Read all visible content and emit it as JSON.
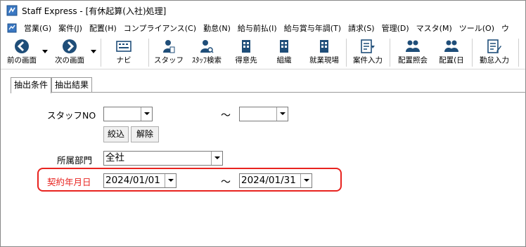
{
  "window": {
    "title": "Staff Express - [有休起算(入社)処理]"
  },
  "menubar": {
    "items": [
      "営業(G)",
      "案件(J)",
      "配置(H)",
      "コンプライアンス(C)",
      "勤怠(N)",
      "給与前払(I)",
      "給与賞与年調(T)",
      "請求(S)",
      "管理(D)",
      "マスタ(M)",
      "ツール(O)",
      "ウ"
    ]
  },
  "toolbar": {
    "buttons": [
      {
        "label": "前の画面",
        "icon": "arrow-left-circle-icon"
      },
      {
        "label": "次の画面",
        "icon": "arrow-right-circle-icon"
      },
      {
        "label": "ナビ",
        "icon": "navi-keyboard-icon"
      },
      {
        "label": "スタッフ",
        "icon": "staff-person-icon"
      },
      {
        "label": "ｽﾀｯﾌ検索",
        "icon": "staff-search-icon"
      },
      {
        "label": "得意先",
        "icon": "client-building-icon"
      },
      {
        "label": "組織",
        "icon": "organization-building-icon"
      },
      {
        "label": "就業現場",
        "icon": "worksite-building-icon"
      },
      {
        "label": "案件入力",
        "icon": "job-input-icon"
      },
      {
        "label": "配置照会",
        "icon": "placement-inquiry-icon"
      },
      {
        "label": "配置(日",
        "icon": "placement-daily-icon"
      },
      {
        "label": "勤怠入力",
        "icon": "attendance-input-icon"
      }
    ]
  },
  "tabs": [
    {
      "label": "抽出条件",
      "active": true
    },
    {
      "label": "抽出結果",
      "active": false
    }
  ],
  "form": {
    "staff_no_label": "スタッフNO",
    "staff_no_from": "",
    "staff_no_to": "",
    "range_sep": "～",
    "narrow_button": "絞込",
    "clear_button": "解除",
    "department_label": "所属部門",
    "department_value": "全社",
    "contract_date_label": "契約年月日",
    "contract_date_from": "2024/01/01",
    "contract_date_to": "2024/01/31"
  },
  "colors": {
    "highlight": "#e8231f",
    "label_red": "#e8231f",
    "icon_blue": "#1f4e79"
  }
}
